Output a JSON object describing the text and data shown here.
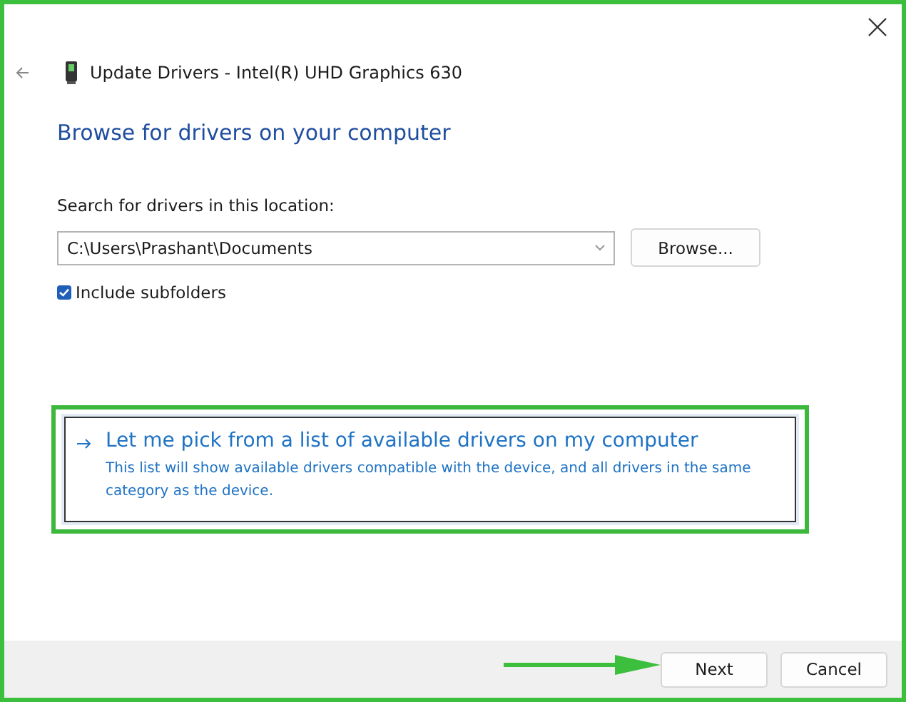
{
  "window": {
    "title": "Update Drivers - Intel(R) UHD Graphics 630"
  },
  "heading": "Browse for drivers on your computer",
  "search": {
    "label": "Search for drivers in this location:",
    "value": "C:\\Users\\Prashant\\Documents",
    "browse_button": "Browse..."
  },
  "include_subfolders": {
    "label": "Include subfolders",
    "checked": true
  },
  "option": {
    "title": "Let me pick from a list of available drivers on my computer",
    "description": "This list will show available drivers compatible with the device, and all drivers in the same category as the device."
  },
  "buttons": [
    "Next",
    "Cancel"
  ]
}
